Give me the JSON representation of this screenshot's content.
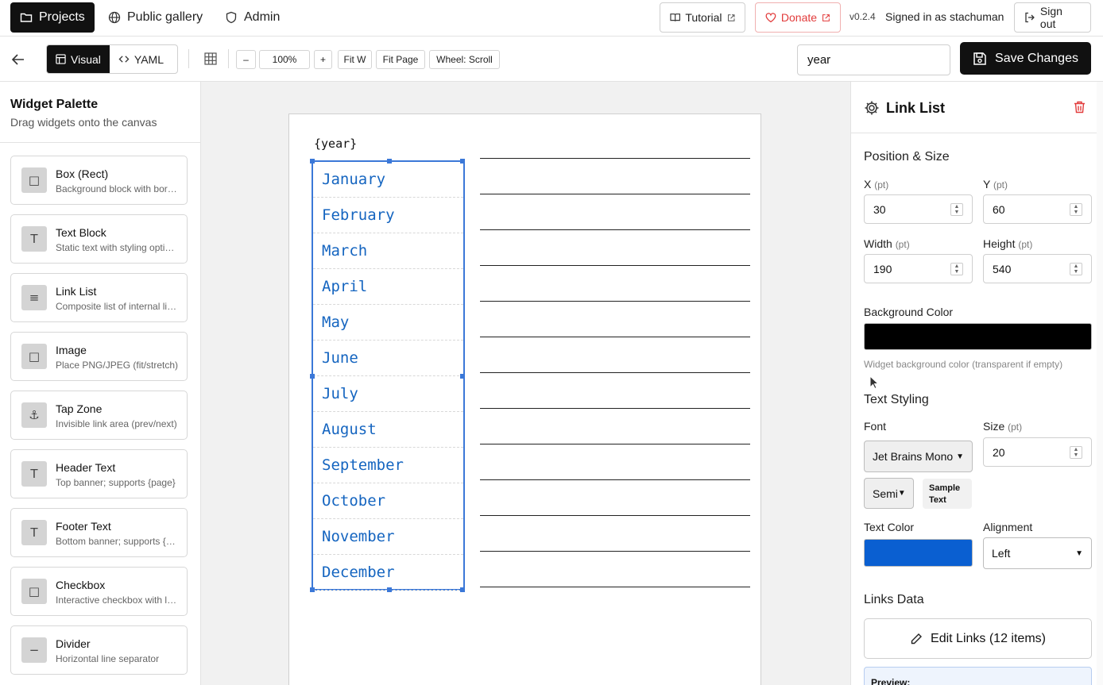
{
  "topnav": {
    "projects": "Projects",
    "gallery": "Public gallery",
    "admin": "Admin",
    "tutorial": "Tutorial",
    "donate": "Donate",
    "version": "v0.2.4",
    "signed_in": "Signed in as stachuman",
    "sign_out": "Sign out"
  },
  "toolbar": {
    "visual": "Visual",
    "yaml": "YAML",
    "zoom_out": "–",
    "zoom": "100%",
    "zoom_in": "+",
    "fit_w": "Fit W",
    "fit_page": "Fit Page",
    "wheel": "Wheel: Scroll",
    "search_value": "year",
    "save": "Save Changes"
  },
  "palette": {
    "title": "Widget Palette",
    "subtitle": "Drag widgets onto the canvas",
    "items": [
      {
        "name": "Box (Rect)",
        "desc": "Background block with borders",
        "icon": "square-icon"
      },
      {
        "name": "Text Block",
        "desc": "Static text with styling options",
        "icon": "text-icon"
      },
      {
        "name": "Link List",
        "desc": "Composite list of internal links",
        "icon": "list-icon"
      },
      {
        "name": "Image",
        "desc": "Place PNG/JPEG (fit/stretch)",
        "icon": "square-icon"
      },
      {
        "name": "Tap Zone",
        "desc": "Invisible link area (prev/next)",
        "icon": "anchor-icon"
      },
      {
        "name": "Header Text",
        "desc": "Top banner; supports {page}",
        "icon": "text-icon"
      },
      {
        "name": "Footer Text",
        "desc": "Bottom banner; supports {page}",
        "icon": "text-icon"
      },
      {
        "name": "Checkbox",
        "desc": "Interactive checkbox with label",
        "icon": "square-icon"
      },
      {
        "name": "Divider",
        "desc": "Horizontal line separator",
        "icon": "minus-icon"
      }
    ]
  },
  "canvas": {
    "year_placeholder": "{year}",
    "months": [
      "January",
      "February",
      "March",
      "April",
      "May",
      "June",
      "July",
      "August",
      "September",
      "October",
      "November",
      "December"
    ]
  },
  "props": {
    "title": "Link List",
    "position_size": "Position & Size",
    "x_label": "X",
    "y_label": "Y",
    "width_label": "Width",
    "height_label": "Height",
    "unit": "(pt)",
    "x": "30",
    "y": "60",
    "width": "190",
    "height": "540",
    "bg_label": "Background Color",
    "bg_color": "#000000",
    "bg_hint": "Widget background color (transparent if empty)",
    "text_styling": "Text Styling",
    "font_label": "Font",
    "font_value": "Jet Brains Mono",
    "size_label": "Size",
    "size_value": "20",
    "weight_value": "Semi",
    "sample": "Sample Text",
    "text_color_label": "Text Color",
    "text_color": "#0a5fd1",
    "alignment_label": "Alignment",
    "alignment_value": "Left",
    "links_data": "Links Data",
    "edit_links": "Edit Links (12 items)",
    "preview": "Preview:"
  }
}
